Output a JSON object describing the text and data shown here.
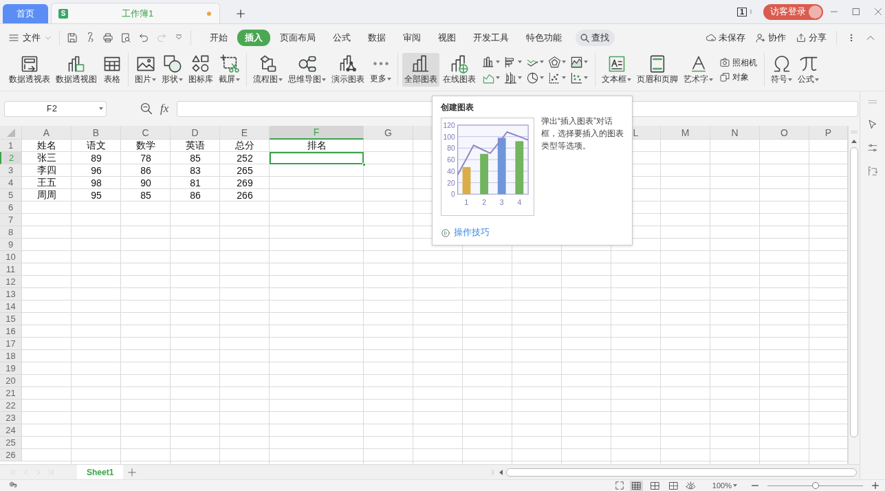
{
  "title_bar": {
    "tabs": [
      {
        "kind": "home",
        "label": "首页",
        "selected": false
      },
      {
        "kind": "document",
        "label": "工作簿1",
        "app_letter": "S",
        "unsaved": true,
        "selected": true
      }
    ],
    "window_count": "1",
    "login": "访客登录"
  },
  "menu_bar": {
    "file": "文件",
    "tabs": [
      {
        "label": "开始",
        "selected": false
      },
      {
        "label": "插入",
        "selected": true
      },
      {
        "label": "页面布局",
        "selected": false
      },
      {
        "label": "公式",
        "selected": false
      },
      {
        "label": "数据",
        "selected": false
      },
      {
        "label": "审阅",
        "selected": false
      },
      {
        "label": "视图",
        "selected": false
      },
      {
        "label": "开发工具",
        "selected": false
      },
      {
        "label": "特色功能",
        "selected": false
      }
    ],
    "search": "查找",
    "actions": [
      "未保存",
      "协作",
      "分享"
    ]
  },
  "ribbon": {
    "groups": [
      {
        "items": [
          {
            "kind": "large",
            "label": "数据透视表",
            "dropdown": false,
            "highlighted": false
          },
          {
            "kind": "large",
            "label": "数据透视图",
            "dropdown": false,
            "highlighted": false
          },
          {
            "kind": "large",
            "label": "表格",
            "dropdown": false,
            "highlighted": false
          }
        ]
      },
      {
        "items": [
          {
            "kind": "large",
            "label": "图片",
            "dropdown": true,
            "highlighted": false
          },
          {
            "kind": "large",
            "label": "形状",
            "dropdown": true,
            "highlighted": false
          },
          {
            "kind": "large",
            "label": "图标库",
            "dropdown": false,
            "highlighted": false
          },
          {
            "kind": "large",
            "label": "截屏",
            "dropdown": true,
            "highlighted": false
          }
        ]
      },
      {
        "items": [
          {
            "kind": "large",
            "label": "流程图",
            "dropdown": true,
            "highlighted": false
          },
          {
            "kind": "large",
            "label": "思维导图",
            "dropdown": true,
            "highlighted": false
          },
          {
            "kind": "large",
            "label": "演示图表",
            "dropdown": false,
            "highlighted": false
          },
          {
            "kind": "large",
            "label": "更多",
            "dropdown": true,
            "highlighted": false
          }
        ]
      },
      {
        "items": [
          {
            "kind": "large",
            "label": "全部图表",
            "dropdown": false,
            "highlighted": true
          },
          {
            "kind": "large",
            "label": "在线图表",
            "dropdown": false,
            "highlighted": false
          },
          {
            "kind": "chart-grid"
          }
        ]
      },
      {
        "items": [
          {
            "kind": "large",
            "label": "文本框",
            "dropdown": true,
            "highlighted": false
          },
          {
            "kind": "large",
            "label": "页眉和页脚",
            "dropdown": false,
            "highlighted": false
          },
          {
            "kind": "large",
            "label": "艺术字",
            "dropdown": true,
            "highlighted": false
          },
          {
            "kind": "small-stack",
            "labels": [
              "照相机",
              "对象"
            ]
          }
        ]
      },
      {
        "items": [
          {
            "kind": "large",
            "label": "符号",
            "dropdown": true,
            "highlighted": false
          },
          {
            "kind": "large",
            "label": "公式",
            "dropdown": true,
            "highlighted": false
          }
        ]
      }
    ]
  },
  "formula_bar": {
    "name_box": "F2",
    "function_label": "fx"
  },
  "sheet": {
    "columns": [
      {
        "label": "A",
        "selected": false
      },
      {
        "label": "B",
        "selected": false
      },
      {
        "label": "C",
        "selected": false
      },
      {
        "label": "D",
        "selected": false
      },
      {
        "label": "E",
        "selected": false
      },
      {
        "label": "F",
        "selected": true
      },
      {
        "label": "G",
        "selected": false
      },
      {
        "label": "L",
        "selected": false
      },
      {
        "label": "M",
        "selected": false
      },
      {
        "label": "N",
        "selected": false
      },
      {
        "label": "O",
        "selected": false
      },
      {
        "label": "P",
        "selected": false
      }
    ],
    "rows": [
      {
        "header": "1",
        "selected": false,
        "cells": [
          "姓名",
          "语文",
          "数学",
          "英语",
          "总分",
          "排名"
        ]
      },
      {
        "header": "2",
        "selected": true,
        "cells": [
          "张三",
          "89",
          "78",
          "85",
          "252"
        ]
      },
      {
        "header": "3",
        "selected": false,
        "cells": [
          "李四",
          "96",
          "86",
          "83",
          "265"
        ]
      },
      {
        "header": "4",
        "selected": false,
        "cells": [
          "王五",
          "98",
          "90",
          "81",
          "269"
        ]
      },
      {
        "header": "5",
        "selected": false,
        "cells": [
          "周周",
          "95",
          "85",
          "86",
          "266"
        ]
      },
      {
        "header": "6",
        "selected": false
      },
      {
        "header": "7",
        "selected": false
      },
      {
        "header": "8",
        "selected": false
      },
      {
        "header": "9",
        "selected": false
      },
      {
        "header": "10",
        "selected": false
      },
      {
        "header": "11",
        "selected": false
      },
      {
        "header": "12",
        "selected": false
      },
      {
        "header": "13",
        "selected": false
      },
      {
        "header": "14",
        "selected": false
      },
      {
        "header": "15",
        "selected": false
      },
      {
        "header": "16",
        "selected": false
      },
      {
        "header": "17",
        "selected": false
      },
      {
        "header": "18",
        "selected": false
      },
      {
        "header": "19",
        "selected": false
      },
      {
        "header": "20",
        "selected": false
      },
      {
        "header": "21",
        "selected": false
      },
      {
        "header": "22",
        "selected": false
      },
      {
        "header": "23",
        "selected": false
      },
      {
        "header": "24",
        "selected": false
      },
      {
        "header": "25",
        "selected": false
      },
      {
        "header": "26",
        "selected": false
      }
    ]
  },
  "tooltip": {
    "title": "创建图表",
    "chart_data": {
      "type": "bar",
      "grid": true,
      "x": [
        0.5,
        1,
        1.4,
        2,
        2.35,
        3,
        3.3,
        4,
        4.5
      ],
      "xlim": [
        0.5,
        4.5
      ],
      "xticks": [
        1,
        2,
        3,
        4
      ],
      "ylim": [
        0,
        120
      ],
      "yticks": [
        0,
        20,
        40,
        60,
        80,
        100,
        120
      ],
      "series": [
        {
          "color": "#d9ae4a",
          "values": [
            null,
            47,
            null,
            null,
            null,
            null,
            null,
            null,
            null
          ]
        },
        {
          "color": "#72b45f",
          "values": [
            null,
            null,
            null,
            70,
            null,
            null,
            null,
            92,
            null
          ]
        },
        {
          "color": "#7095d9",
          "values": [
            null,
            null,
            null,
            null,
            null,
            98,
            null,
            null,
            null
          ]
        },
        {
          "type": "line",
          "color": "#8c86c4",
          "values": [
            34,
            62,
            85,
            76,
            71,
            96,
            108,
            100,
            94
          ]
        }
      ]
    },
    "description": "弹出“插入图表”对话框，选择要插入的图表类型等选项。",
    "link": "操作技巧"
  },
  "sheet_tabs": [
    {
      "label": "Sheet1",
      "selected": true
    }
  ],
  "status_bar": {
    "zoom": "100%",
    "zoom_slider": {
      "level": 0.5
    },
    "view_modes": [
      {
        "selected": true
      },
      {
        "selected": false
      },
      {
        "selected": false
      }
    ]
  }
}
